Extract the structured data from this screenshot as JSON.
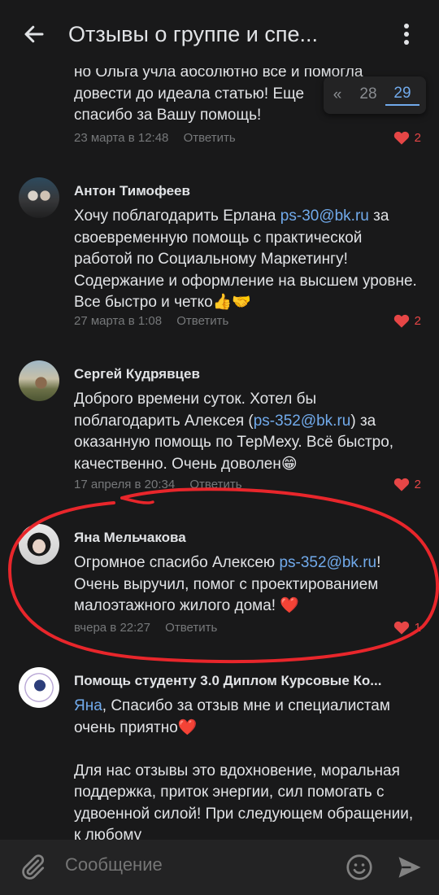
{
  "header": {
    "title": "Отзывы о группе и спе..."
  },
  "pager": {
    "prev": "«",
    "pages": [
      "28",
      "29"
    ],
    "active": "29"
  },
  "comments": [
    {
      "text_lines": [
        "но Ольга учла абсолютно все и помогла",
        "довести до идеала статью! Еще",
        "спасибо за Вашу помощь!"
      ],
      "date": "23 марта в 12:48",
      "reply": "Ответить",
      "likes": "2"
    },
    {
      "author": "Антон Тимофеев",
      "text_pre": "Хочу поблагодарить Ерлана ",
      "text_link": "ps-30@bk.ru",
      "text_post": " за своевременную помощь с практической работой по Социальному Маркетингу! Содержание и оформление на высшем уровне. Все быстро и четко👍🤝",
      "date": "27 марта в 1:08",
      "reply": "Ответить",
      "likes": "2"
    },
    {
      "author": "Сергей Кудрявцев",
      "text_pre": "Доброго времени суток.  Хотел бы поблагодарить Алексея (",
      "text_link": "ps-352@bk.ru",
      "text_post": ") за  оказанную помощь по ТерМеху. Всё быстро, качественно.  Очень доволен😁",
      "date": "17 апреля в 20:34",
      "reply": "Ответить",
      "likes": "2"
    },
    {
      "author": "Яна Мельчакова",
      "text_pre": "Огромное спасибо Алексею ",
      "text_link": "ps-352@bk.ru",
      "text_post": "! Очень выручил, помог с проектированием малоэтажного жилого дома! ❤️",
      "date": "вчера в 22:27",
      "reply": "Ответить",
      "likes": "1"
    },
    {
      "author": "Помощь студенту 3.0 Диплом Курсовые Ко...",
      "text_link": "Яна",
      "text_post": ", Спасибо за отзыв мне и специалистам очень приятно❤️",
      "text_para2": "Для нас отзывы это вдохновение, моральная поддержка, приток энергии, сил помогать с удвоенной силой! При следующем обращении, к любому"
    }
  ],
  "composer": {
    "placeholder": "Сообщение"
  },
  "colors": {
    "background": "#19191a",
    "link": "#71aaeb",
    "like": "#e64646",
    "annotation": "#e8262b"
  }
}
